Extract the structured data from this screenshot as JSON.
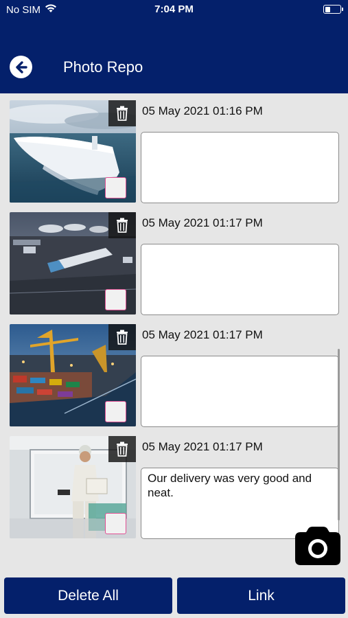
{
  "status_bar": {
    "carrier": "No SIM",
    "time": "7:04 PM",
    "battery_level": 0.3
  },
  "header": {
    "title": "Photo Repo",
    "back_icon": "arrow-left-circle-icon"
  },
  "photos": [
    {
      "image": "autonomous-cargo-ship",
      "timestamp": "05 May 2021 01:16 PM",
      "comment": "",
      "selected": false
    },
    {
      "image": "truck-on-logistics-terminal",
      "timestamp": "05 May 2021 01:17 PM",
      "comment": "",
      "selected": false
    },
    {
      "image": "container-port-at-night",
      "timestamp": "05 May 2021 01:17 PM",
      "comment": "",
      "selected": false
    },
    {
      "image": "worker-with-package",
      "timestamp": "05 May 2021 01:17 PM",
      "comment": "Our delivery was very good and neat.",
      "selected": false
    }
  ],
  "icons": {
    "trash": "trash-icon",
    "camera": "camera-icon",
    "wifi": "wifi-icon",
    "battery": "battery-icon"
  },
  "footer": {
    "delete_all_label": "Delete All",
    "link_label": "Link"
  },
  "colors": {
    "primary": "#04206b",
    "background": "#e6e6e6",
    "checkbox_border": "#e04f92"
  }
}
